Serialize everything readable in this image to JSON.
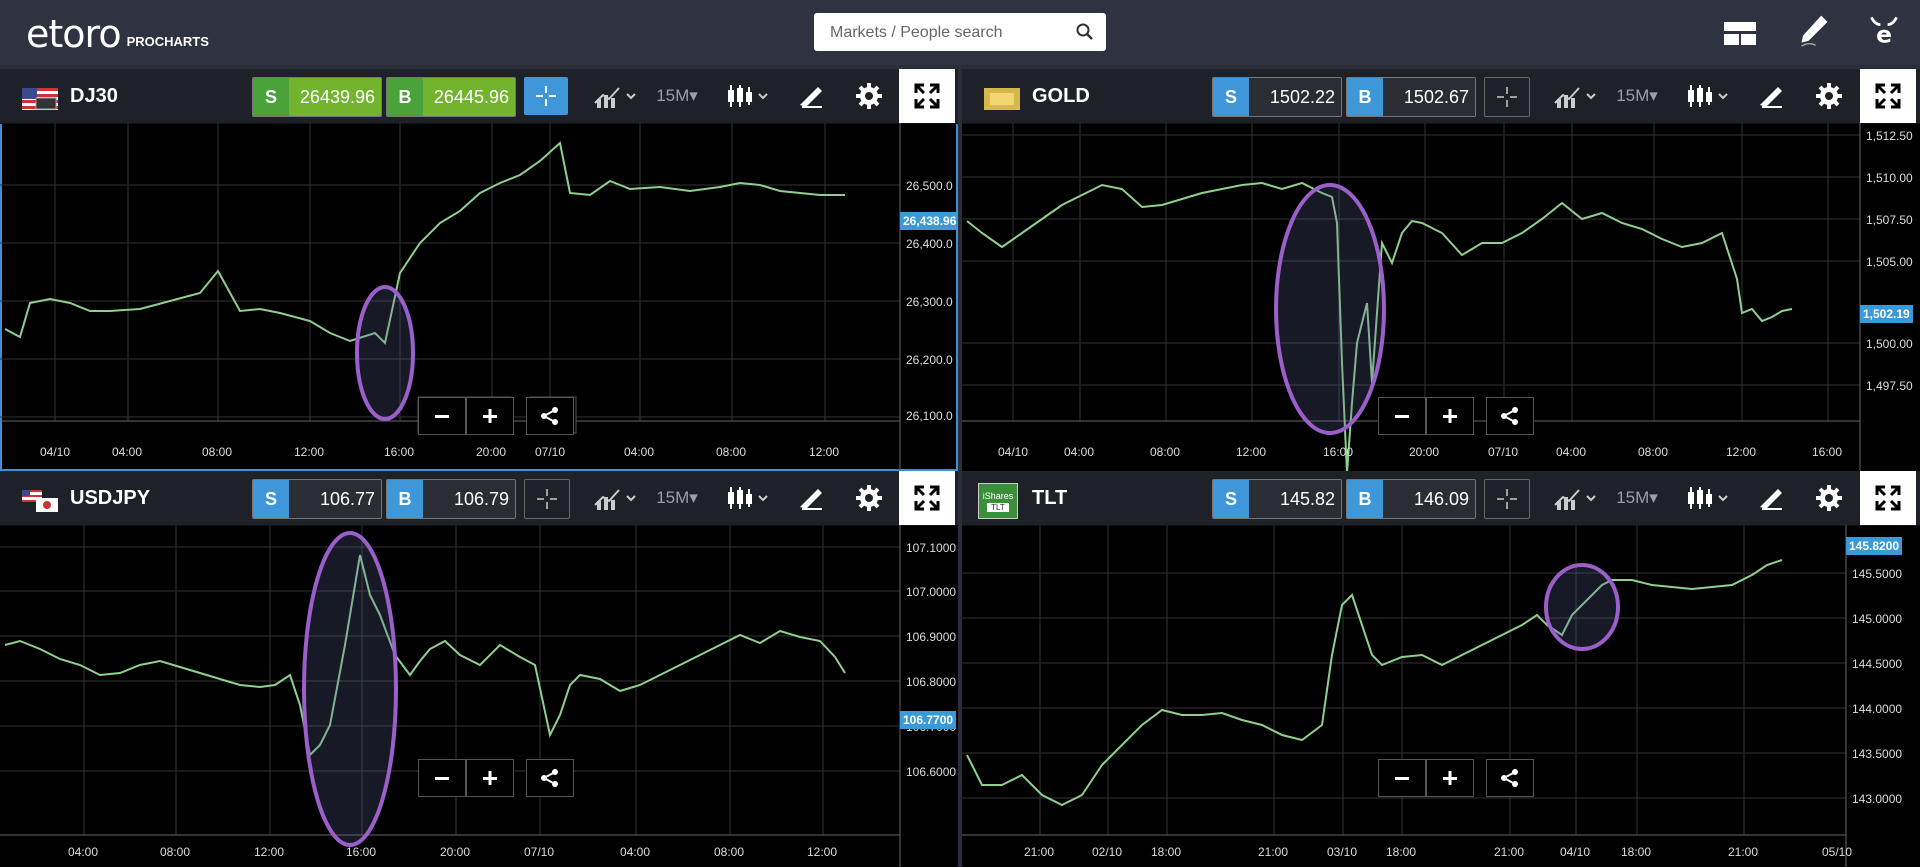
{
  "header": {
    "logo": "etoro",
    "logo_sub": "PROCHARTS",
    "search_placeholder": "Markets / People search",
    "icons": [
      "layout-icon",
      "pencil-icon",
      "etoro-bull-icon"
    ]
  },
  "panels": [
    {
      "instrument": "DJ30",
      "sell_label": "S",
      "sell": "26439.96",
      "buy_label": "B",
      "buy": "26445.96",
      "timeframe": "15M▾",
      "current_price": "26,438.96",
      "y_ticks": [
        "26,500.0",
        "26,400.0",
        "26,300.0",
        "26,200.0",
        "26,100.0"
      ],
      "x_ticks": [
        "04/10",
        "04:00",
        "08:00",
        "12:00",
        "16:00",
        "20:00",
        "07/10",
        "04:00",
        "08:00",
        "12:00"
      ]
    },
    {
      "instrument": "GOLD",
      "sell_label": "S",
      "sell": "1502.22",
      "buy_label": "B",
      "buy": "1502.67",
      "timeframe": "15M▾",
      "current_price": "1,502.19",
      "y_ticks": [
        "1,512.50",
        "1,510.00",
        "1,507.50",
        "1,505.00",
        "1,500.00",
        "1,497.50"
      ],
      "x_ticks": [
        "04/10",
        "04:00",
        "08:00",
        "12:00",
        "16:00",
        "20:00",
        "07/10",
        "04:00",
        "08:00",
        "12:00",
        "16:00"
      ]
    },
    {
      "instrument": "USDJPY",
      "sell_label": "S",
      "sell": "106.77",
      "buy_label": "B",
      "buy": "106.79",
      "timeframe": "15M▾",
      "current_price": "106.7700",
      "y_ticks": [
        "107.1000",
        "107.0000",
        "106.9000",
        "106.8000",
        "106.7000",
        "106.6000"
      ],
      "x_ticks": [
        "04:00",
        "08:00",
        "12:00",
        "16:00",
        "20:00",
        "07/10",
        "04:00",
        "08:00",
        "12:00"
      ]
    },
    {
      "instrument": "TLT",
      "sell_label": "S",
      "sell": "145.82",
      "buy_label": "B",
      "buy": "146.09",
      "timeframe": "15M▾",
      "current_price": "145.8200",
      "flag_text": "iShares",
      "flag_sub": "TLT",
      "y_ticks": [
        "145.5000",
        "145.0000",
        "144.5000",
        "144.0000",
        "143.5000",
        "143.0000"
      ],
      "x_ticks": [
        "21:00",
        "02/10",
        "18:00",
        "21:00",
        "03/10",
        "18:00",
        "21:00",
        "04/10",
        "18:00",
        "21:00",
        "05/10"
      ]
    }
  ],
  "zoom_out": "−",
  "zoom_in": "+"
}
